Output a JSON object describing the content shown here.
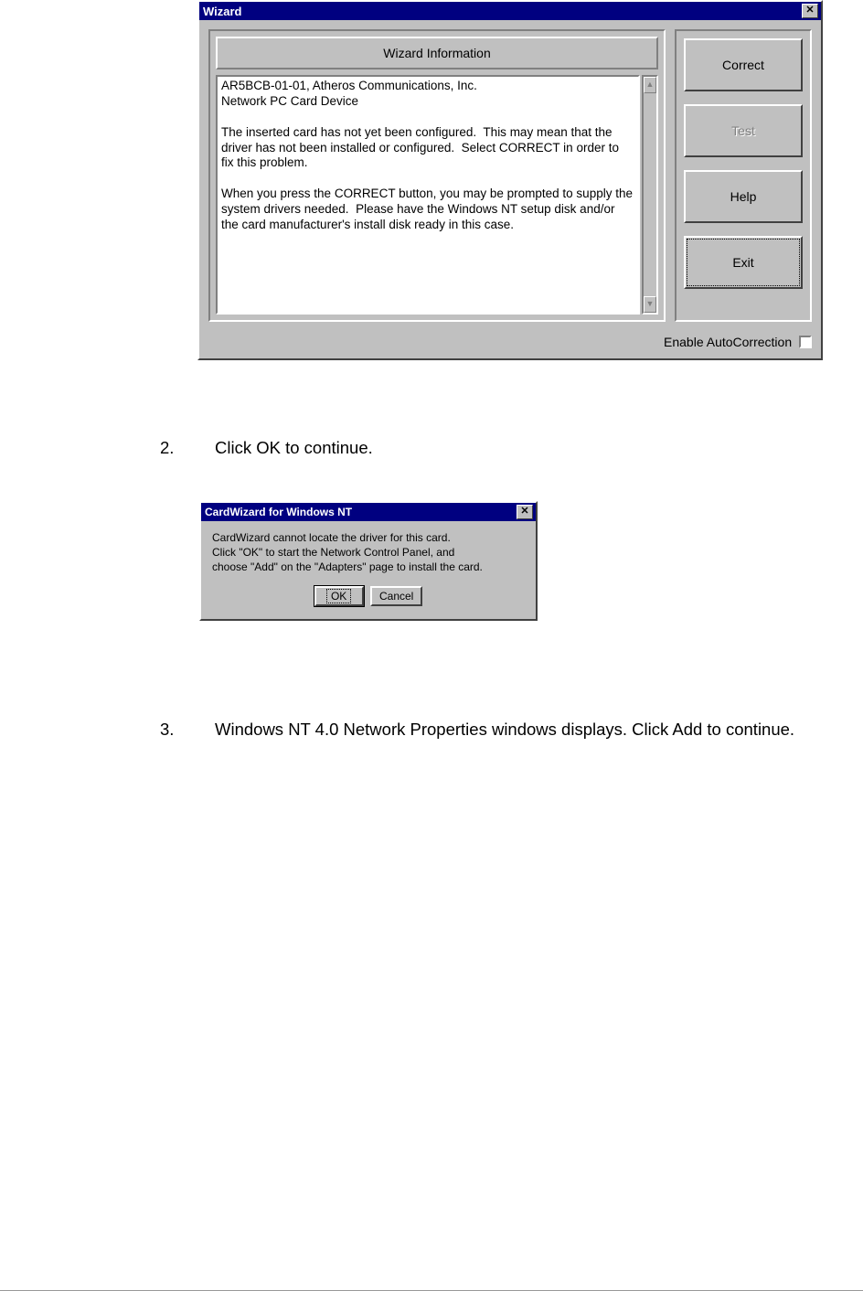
{
  "wizard": {
    "title": "Wizard",
    "group_header": "Wizard Information",
    "info_text": "AR5BCB-01-01, Atheros Communications, Inc.\nNetwork PC Card Device\n\nThe inserted card has not yet been configured.  This may mean that the driver has not been installed or configured.  Select CORRECT in order to fix this problem.\n\nWhen you press the CORRECT button, you may be prompted to supply the system drivers needed.  Please have the Windows NT setup disk and/or the card manufacturer's install disk ready in this case.",
    "buttons": {
      "correct": "Correct",
      "test": "Test",
      "help": "Help",
      "exit": "Exit"
    },
    "footer_label": "Enable AutoCorrection"
  },
  "steps": {
    "s2_num": "2.",
    "s2_text": "Click OK to continue.",
    "s3_num": "3.",
    "s3_text": "Windows NT 4.0 Network Properties windows displays. Click Add to continue."
  },
  "cardwiz": {
    "title": "CardWizard for Windows NT",
    "text": "CardWizard cannot locate the driver for this card.\nClick \"OK\" to start the Network Control Panel, and\nchoose \"Add\" on the \"Adapters\" page to install the card.",
    "ok": "OK",
    "cancel": "Cancel"
  }
}
